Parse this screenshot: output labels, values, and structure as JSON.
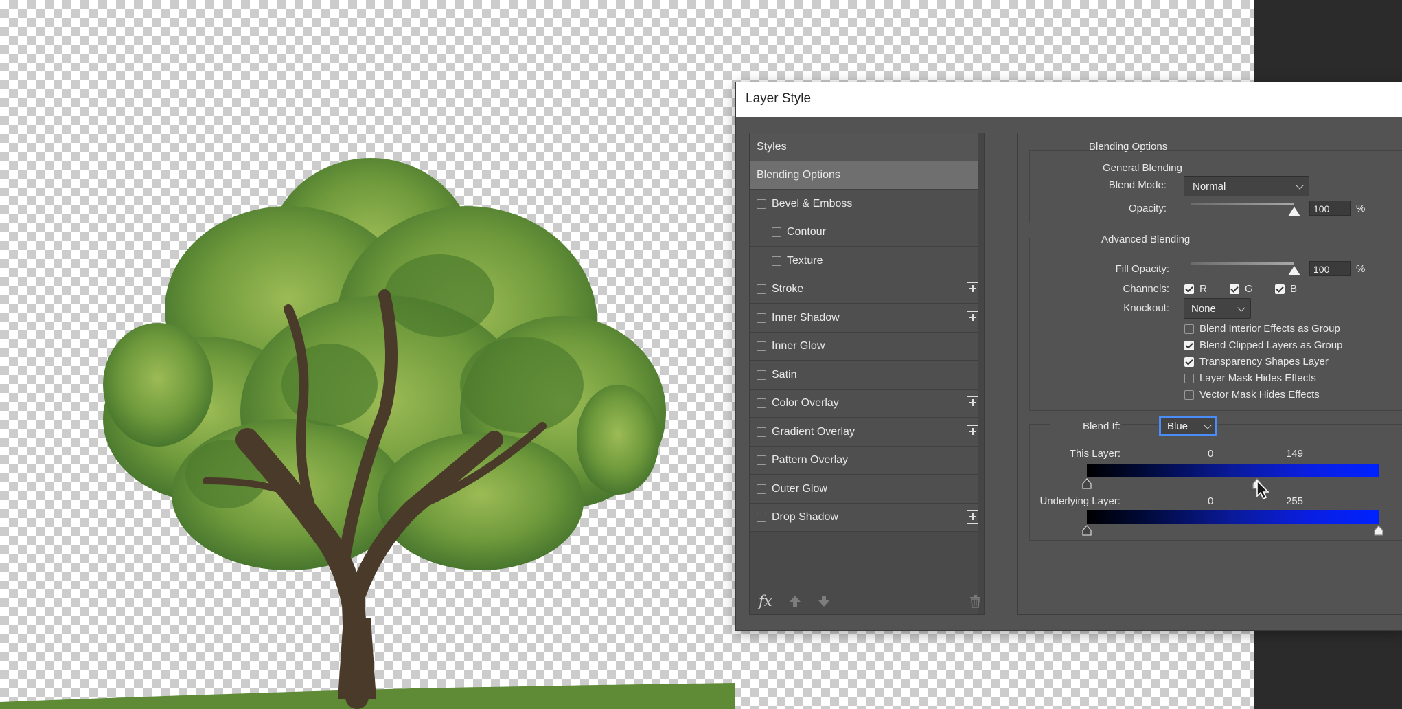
{
  "dialog": {
    "title": "Layer Style"
  },
  "styles_list": {
    "header": "Styles",
    "items": [
      {
        "label": "Blending Options",
        "checkbox": false,
        "checked": false,
        "plus": false,
        "selected": true
      },
      {
        "label": "Bevel & Emboss",
        "checkbox": true,
        "checked": false,
        "plus": false
      },
      {
        "label": "Contour",
        "checkbox": true,
        "checked": false,
        "plus": false
      },
      {
        "label": "Texture",
        "checkbox": true,
        "checked": false,
        "plus": false
      },
      {
        "label": "Stroke",
        "checkbox": true,
        "checked": false,
        "plus": true
      },
      {
        "label": "Inner Shadow",
        "checkbox": true,
        "checked": false,
        "plus": true
      },
      {
        "label": "Inner Glow",
        "checkbox": true,
        "checked": false,
        "plus": false
      },
      {
        "label": "Satin",
        "checkbox": true,
        "checked": false,
        "plus": false
      },
      {
        "label": "Color Overlay",
        "checkbox": true,
        "checked": false,
        "plus": true
      },
      {
        "label": "Gradient Overlay",
        "checkbox": true,
        "checked": false,
        "plus": true
      },
      {
        "label": "Pattern Overlay",
        "checkbox": true,
        "checked": false,
        "plus": false
      },
      {
        "label": "Outer Glow",
        "checkbox": true,
        "checked": false,
        "plus": false
      },
      {
        "label": "Drop Shadow",
        "checkbox": true,
        "checked": false,
        "plus": true
      }
    ],
    "footer": {
      "fx_label": "fx",
      "icons": [
        "fx-icon",
        "arrow-up-icon",
        "arrow-down-icon",
        "trash-icon"
      ]
    }
  },
  "blending_options": {
    "title": "Blending Options",
    "general": {
      "title": "General Blending",
      "blend_mode_label": "Blend Mode:",
      "blend_mode_value": "Normal",
      "opacity_label": "Opacity:",
      "opacity_value": "100",
      "opacity_percent": 100,
      "percent_sign": "%"
    },
    "advanced": {
      "title": "Advanced Blending",
      "fill_opacity_label": "Fill Opacity:",
      "fill_opacity_value": "100",
      "fill_opacity_percent": 100,
      "percent_sign": "%",
      "channels_label": "Channels:",
      "channels": [
        {
          "label": "R",
          "checked": true
        },
        {
          "label": "G",
          "checked": true
        },
        {
          "label": "B",
          "checked": true
        }
      ],
      "knockout_label": "Knockout:",
      "knockout_value": "None",
      "options": [
        {
          "label": "Blend Interior Effects as Group",
          "checked": false
        },
        {
          "label": "Blend Clipped Layers as Group",
          "checked": true
        },
        {
          "label": "Transparency Shapes Layer",
          "checked": true
        },
        {
          "label": "Layer Mask Hides Effects",
          "checked": false
        },
        {
          "label": "Vector Mask Hides Effects",
          "checked": false
        }
      ]
    },
    "blend_if": {
      "label": "Blend If:",
      "value": "Blue",
      "this_layer": {
        "label": "This Layer:",
        "low": "0",
        "high": "149",
        "low_value": 0,
        "high_value": 149
      },
      "underlying_layer": {
        "label": "Underlying Layer:",
        "low": "0",
        "high": "255",
        "low_value": 0,
        "high_value": 255
      }
    }
  },
  "colors": {
    "dialog_bg": "#535353",
    "gradient_end": "#0022ff"
  }
}
